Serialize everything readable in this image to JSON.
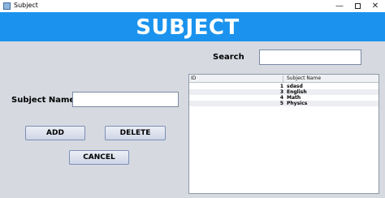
{
  "window": {
    "title": "Subject",
    "controls": {
      "minimize": "—",
      "close": "✕"
    }
  },
  "header": {
    "title": "SUBJECT",
    "band_color": "#1b93ee"
  },
  "search": {
    "label": "Search",
    "value": ""
  },
  "form": {
    "subject_label": "Subject Name",
    "subject_value": ""
  },
  "buttons": {
    "add": "ADD",
    "delete": "DELETE",
    "cancel": "CANCEL"
  },
  "table": {
    "columns": [
      "ID",
      "Subject Name"
    ],
    "rows": [
      {
        "id": "1",
        "name": "sdasd"
      },
      {
        "id": "3",
        "name": "English"
      },
      {
        "id": "4",
        "name": "Math"
      },
      {
        "id": "5",
        "name": "Physics"
      }
    ]
  }
}
